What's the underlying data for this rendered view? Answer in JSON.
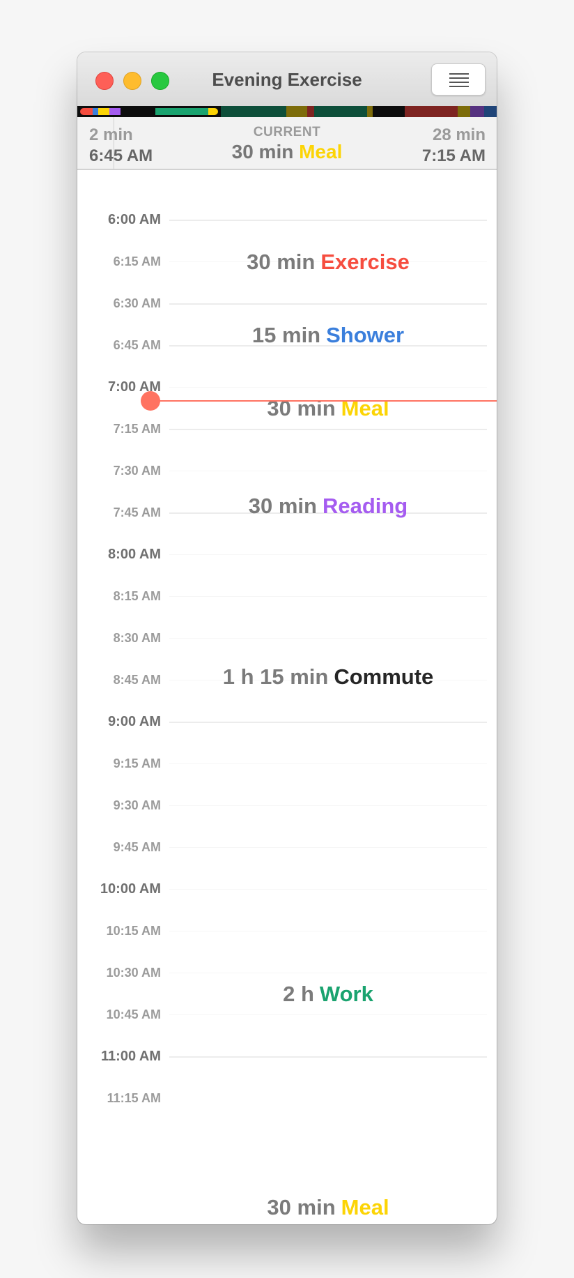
{
  "window": {
    "title": "Evening Exercise"
  },
  "colors": {
    "exercise": "#f64d3f",
    "shower": "#3b7fdc",
    "meal": "#fcd405",
    "reading": "#a55cf0",
    "commute": "#262626",
    "work": "#1aa36f",
    "now_indicator": "#ff7361"
  },
  "icons": {
    "menu_button": "hamburger-menu-icon"
  },
  "now_bar": {
    "previous": {
      "duration": "2 min",
      "time": "6:45 AM"
    },
    "current_caption": "CURRENT",
    "current_duration": "30 min",
    "current_name": "Meal",
    "next": {
      "duration": "28 min",
      "time": "7:15 AM"
    }
  },
  "timeline": {
    "times": [
      "6:00 AM",
      "6:15 AM",
      "6:30 AM",
      "6:45 AM",
      "7:00 AM",
      "7:15 AM",
      "7:30 AM",
      "7:45 AM",
      "8:00 AM",
      "8:15 AM",
      "8:30 AM",
      "8:45 AM",
      "9:00 AM",
      "9:15 AM",
      "9:30 AM",
      "9:45 AM",
      "10:00 AM",
      "10:15 AM",
      "10:30 AM",
      "10:45 AM",
      "11:00 AM",
      "11:15 AM"
    ],
    "current_time": "6:45 AM",
    "events": [
      {
        "duration": "30 min",
        "name": "Exercise",
        "color": "#f64d3f"
      },
      {
        "duration": "15 min",
        "name": "Shower",
        "color": "#3b7fdc"
      },
      {
        "duration": "30 min",
        "name": "Meal",
        "color": "#fcd405"
      },
      {
        "duration": "30 min",
        "name": "Reading",
        "color": "#a55cf0"
      },
      {
        "duration": "1 h 15 min",
        "name": "Commute",
        "color": "#262626"
      },
      {
        "duration": "2 h",
        "name": "Work",
        "color": "#1aa36f"
      },
      {
        "duration": "30 min",
        "name": "Meal",
        "color": "#fcd405"
      }
    ]
  }
}
